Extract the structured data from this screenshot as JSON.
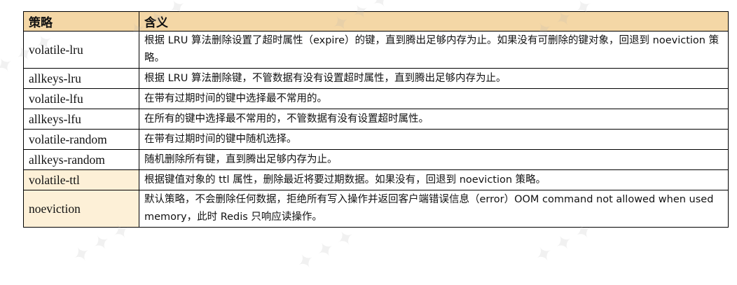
{
  "table": {
    "headers": [
      "策略",
      "含义"
    ],
    "rows": [
      {
        "name": "volatile-lru",
        "desc": "根据 LRU 算法删除设置了超时属性（expire）的键，直到腾出足够内存为止。如果没有可删除的键对象，回退到 noeviction 策略。"
      },
      {
        "name": "allkeys-lru",
        "desc": "根据 LRU 算法删除键，不管数据有没有设置超时属性，直到腾出足够内存为止。"
      },
      {
        "name": "volatile-lfu",
        "desc": "在带有过期时间的键中选择最不常用的。"
      },
      {
        "name": "allkeys-lfu",
        "desc": "在所有的键中选择最不常用的，不管数据有没有设置超时属性。"
      },
      {
        "name": "volatile-random",
        "desc": "在带有过期时间的键中随机选择。"
      },
      {
        "name": "allkeys-random",
        "desc": "随机删除所有键，直到腾出足够内存为止。"
      },
      {
        "name": "volatile-ttl",
        "desc": "根据键值对象的 ttl 属性，删除最近将要过期数据。如果没有，回退到 noeviction 策略。"
      },
      {
        "name": "noeviction",
        "desc": "默认策略，不会删除任何数据，拒绝所有写入操作并返回客户端错误信息（error）OOM command not allowed when used memory，此时 Redis 只响应读操作。"
      }
    ]
  },
  "colors": {
    "header_bg": "#f4d7a6",
    "highlight_bg": "#fdf0d7",
    "border": "#000000"
  }
}
